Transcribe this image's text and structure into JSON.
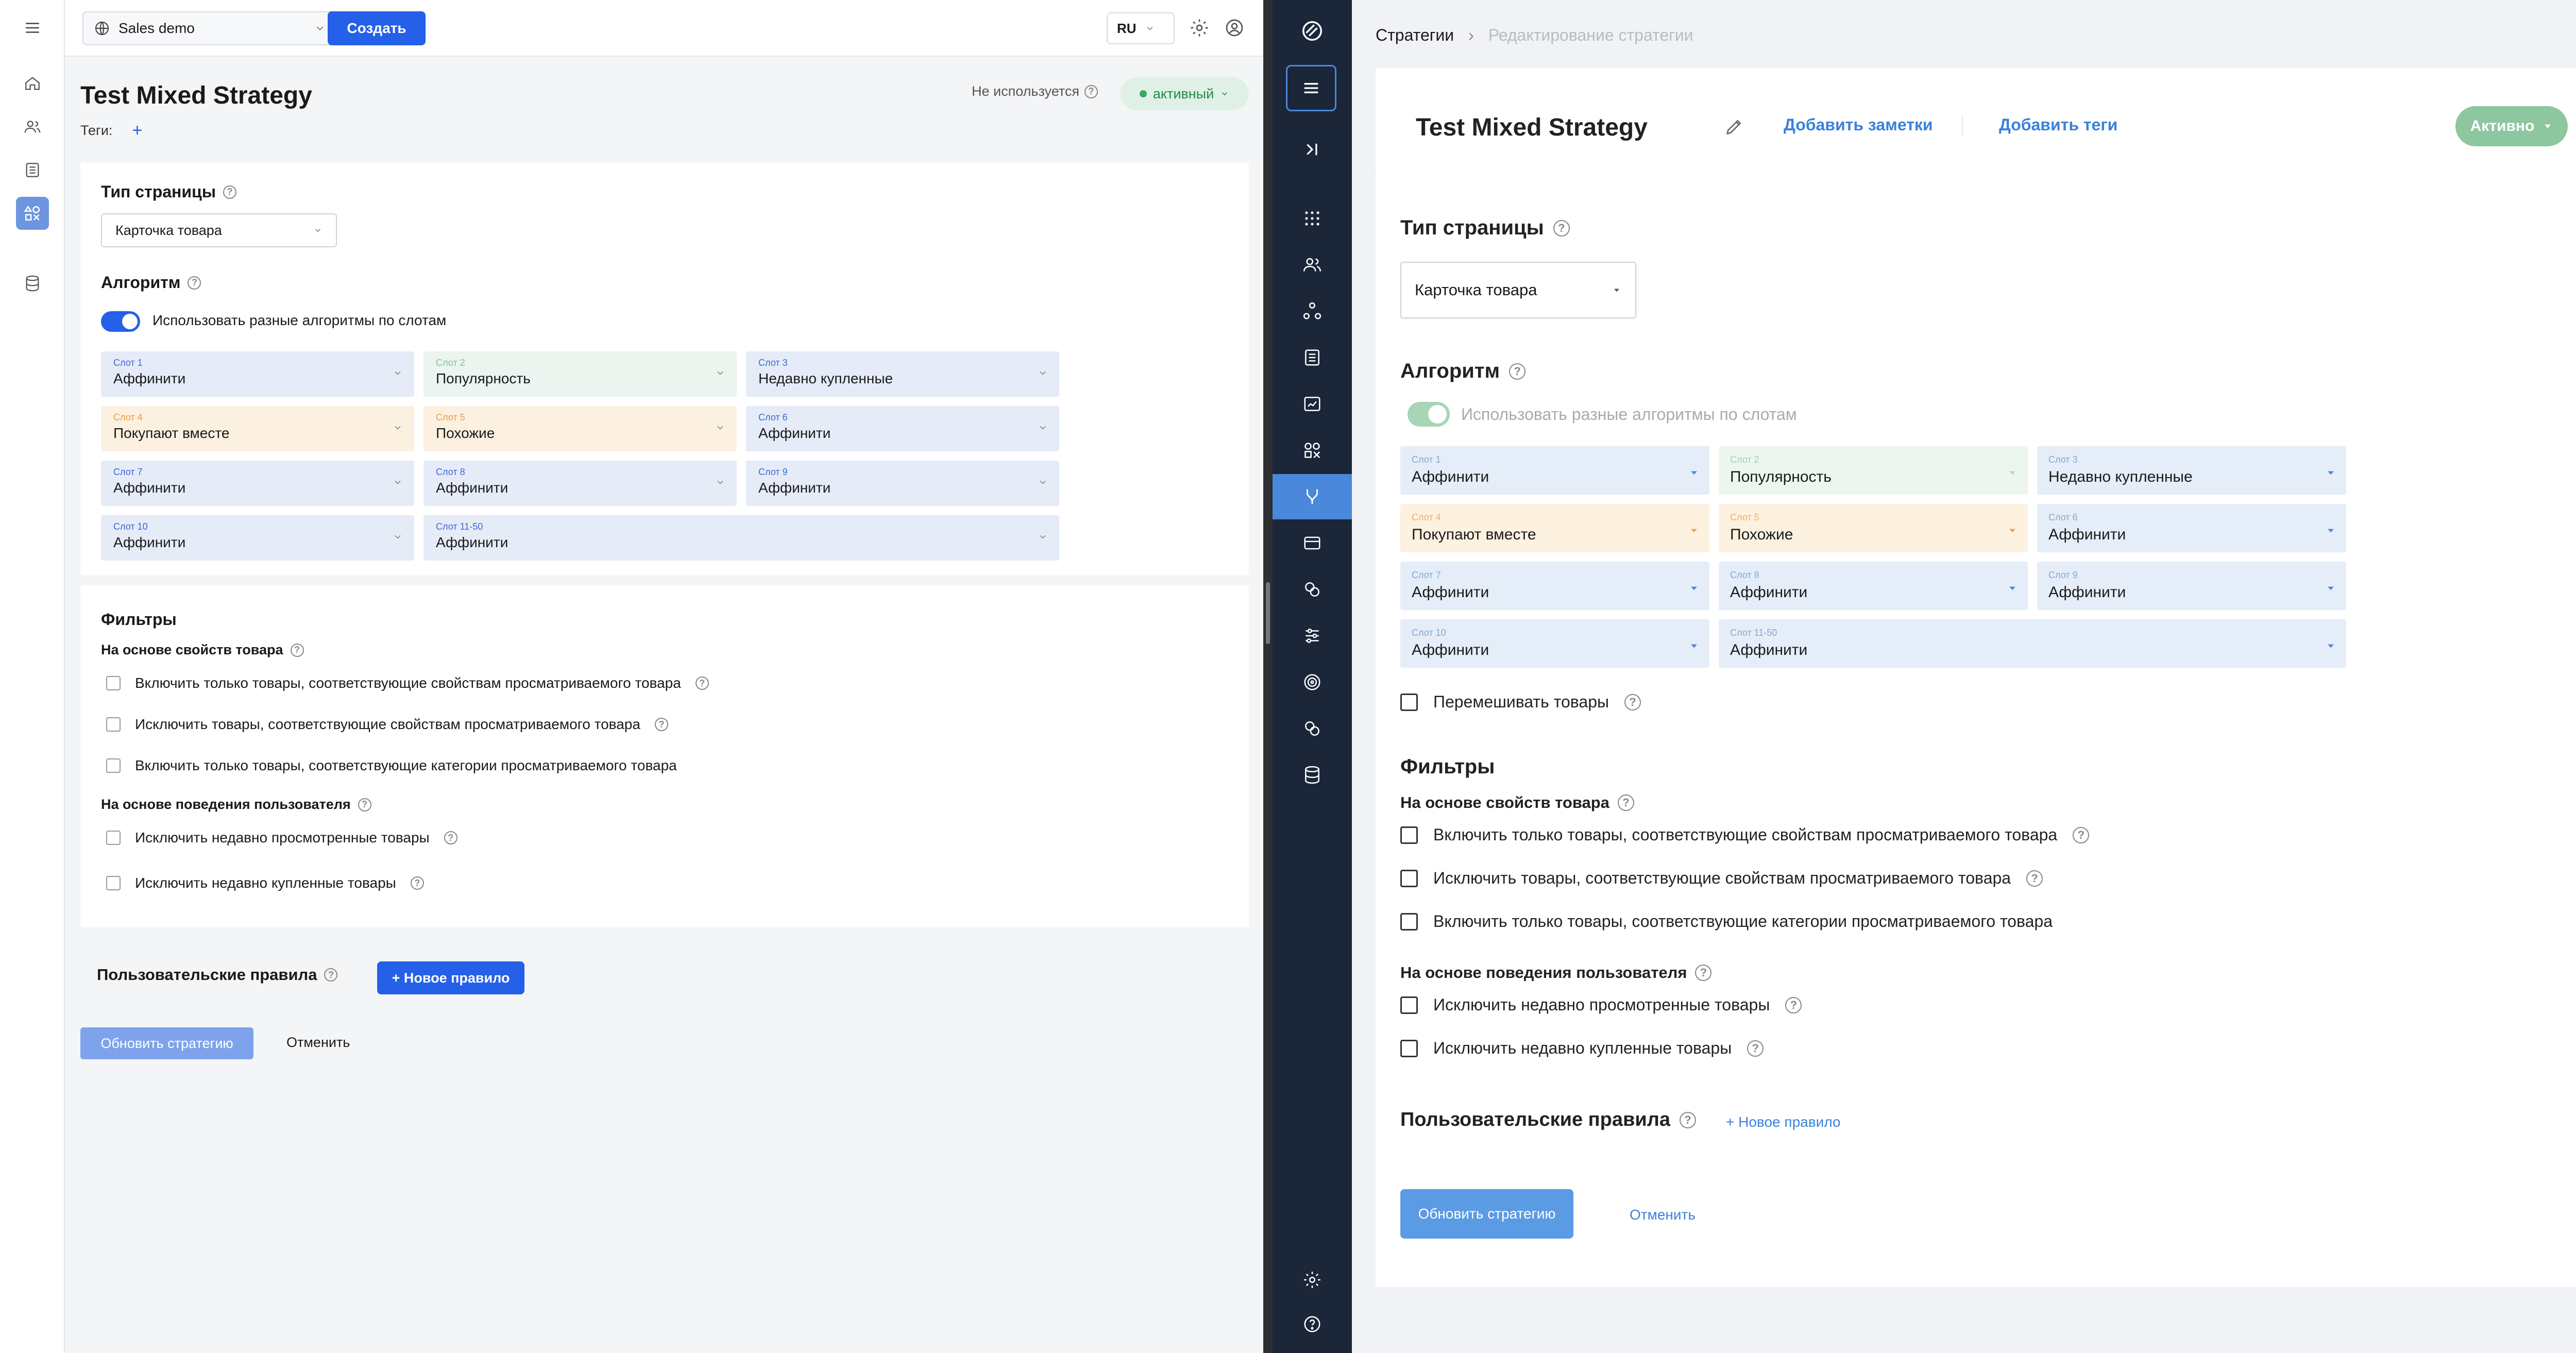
{
  "left": {
    "topbar": {
      "project": "Sales demo",
      "create_label": "Создать",
      "lang": "RU"
    },
    "page": {
      "title": "Test Mixed Strategy",
      "unused_label": "Не используется",
      "status_label": "активный",
      "tags_label": "Теги:",
      "tags_add": "+"
    },
    "page_type": {
      "title": "Тип страницы",
      "value": "Карточка товара"
    },
    "algorithm": {
      "title": "Алгоритм",
      "toggle_label": "Использовать разные алгоритмы по слотам",
      "toggle_on": true,
      "slots": [
        {
          "label": "Слот 1",
          "value": "Аффинити",
          "color": "blue"
        },
        {
          "label": "Слот 2",
          "value": "Популярность",
          "color": "green"
        },
        {
          "label": "Слот 3",
          "value": "Недавно купленные",
          "color": "blue"
        },
        {
          "label": "Слот 4",
          "value": "Покупают вместе",
          "color": "orange"
        },
        {
          "label": "Слот 5",
          "value": "Похожие",
          "color": "orange"
        },
        {
          "label": "Слот 6",
          "value": "Аффинити",
          "color": "blue"
        },
        {
          "label": "Слот 7",
          "value": "Аффинити",
          "color": "blue"
        },
        {
          "label": "Слот 8",
          "value": "Аффинити",
          "color": "blue"
        },
        {
          "label": "Слот 9",
          "value": "Аффинити",
          "color": "blue"
        },
        {
          "label": "Слот 10",
          "value": "Аффинити",
          "color": "blue"
        },
        {
          "label": "Слот 11-50",
          "value": "Аффинити",
          "color": "blue"
        }
      ]
    },
    "filters": {
      "title": "Фильтры",
      "product_group": "На основе свойств товара",
      "product_items": [
        "Включить только товары, соответствующие свойствам просматриваемого товара",
        "Исключить товары, соответствующие свойствам просматриваемого товара",
        "Включить только товары, соответствующие категории просматриваемого товара"
      ],
      "behavior_group": "На основе поведения пользователя",
      "behavior_items": [
        "Исключить недавно просмотренные товары",
        "Исключить недавно купленные товары"
      ]
    },
    "rules": {
      "title": "Пользовательские правила",
      "new_rule": "+ Новое правило"
    },
    "actions": {
      "update": "Обновить стратегию",
      "cancel": "Отменить"
    }
  },
  "right": {
    "breadcrumb": {
      "parent": "Стратегии",
      "sep": "›",
      "current": "Редактирование стратегии"
    },
    "header": {
      "title": "Test Mixed Strategy",
      "add_notes": "Добавить заметки",
      "add_tags": "Добавить теги",
      "status": "Активно"
    },
    "page_type": {
      "title": "Тип страницы",
      "value": "Карточка товара"
    },
    "algorithm": {
      "title": "Алгоритм",
      "toggle_label": "Использовать разные алгоритмы по слотам",
      "slots": [
        {
          "label": "Слот 1",
          "value": "Аффинити",
          "color": "blue"
        },
        {
          "label": "Слот 2",
          "value": "Популярность",
          "color": "green"
        },
        {
          "label": "Слот 3",
          "value": "Недавно купленные",
          "color": "blue"
        },
        {
          "label": "Слот 4",
          "value": "Покупают вместе",
          "color": "orange"
        },
        {
          "label": "Слот 5",
          "value": "Похожие",
          "color": "orange"
        },
        {
          "label": "Слот 6",
          "value": "Аффинити",
          "color": "blue"
        },
        {
          "label": "Слот 7",
          "value": "Аффинити",
          "color": "blue"
        },
        {
          "label": "Слот 8",
          "value": "Аффинити",
          "color": "blue"
        },
        {
          "label": "Слот 9",
          "value": "Аффинити",
          "color": "blue"
        },
        {
          "label": "Слот 10",
          "value": "Аффинити",
          "color": "blue"
        },
        {
          "label": "Слот 11-50",
          "value": "Аффинити",
          "color": "blue"
        }
      ],
      "shuffle_label": "Перемешивать товары"
    },
    "filters": {
      "title": "Фильтры",
      "product_group": "На основе свойств товара",
      "product_items": [
        "Включить только товары, соответствующие свойствам просматриваемого товара",
        "Исключить товары, соответствующие свойствам просматриваемого товара",
        "Включить только товары, соответствующие категории просматриваемого товара"
      ],
      "behavior_group": "На основе поведения пользователя",
      "behavior_items": [
        "Исключить недавно просмотренные товары",
        "Исключить недавно купленные товары"
      ]
    },
    "rules": {
      "title": "Пользовательские правила",
      "new_rule": "+ Новое правило"
    },
    "actions": {
      "update": "Обновить стратегию",
      "cancel": "Отменить"
    }
  },
  "colors": {
    "left_primary": "#2460e8",
    "right_sidebar": "#1b2639",
    "right_accent": "#4a88db",
    "active_green": "#8cc7a0"
  }
}
